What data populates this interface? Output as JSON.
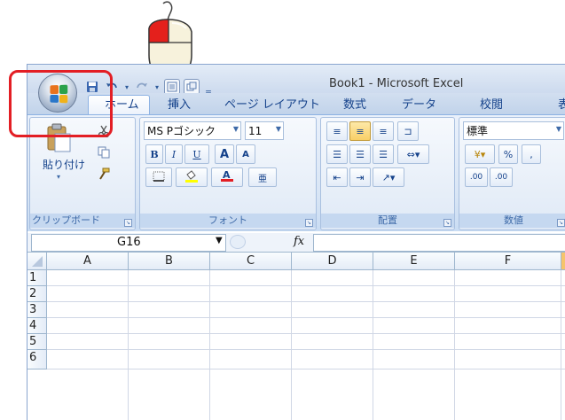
{
  "window": {
    "title": "Book1 - Microsoft Excel"
  },
  "tabs": [
    "ホーム",
    "挿入",
    "ページ レイアウト",
    "数式",
    "データ",
    "校閲",
    "表"
  ],
  "clipboard": {
    "paste_label": "貼り付け",
    "group_label": "クリップボード"
  },
  "font": {
    "name": "MS Pゴシック",
    "size": "11",
    "bold": "B",
    "italic": "I",
    "underline": "U",
    "grow": "A",
    "shrink": "A",
    "group_label": "フォント"
  },
  "alignment": {
    "group_label": "配置"
  },
  "number": {
    "format": "標準",
    "percent": "%",
    "comma": ",",
    "inc_decimal": ".00",
    "dec_decimal": ".00",
    "group_label": "数値"
  },
  "formula_bar": {
    "cell_ref": "G16",
    "fx": "fx"
  },
  "grid": {
    "columns": [
      "A",
      "B",
      "C",
      "D",
      "E",
      "F"
    ],
    "rows": [
      "1",
      "2",
      "3",
      "4",
      "5",
      "6"
    ]
  },
  "colors": {
    "highlight": "#e31e24",
    "font_color": "#e31e24",
    "fill_color": "#ffff00"
  }
}
